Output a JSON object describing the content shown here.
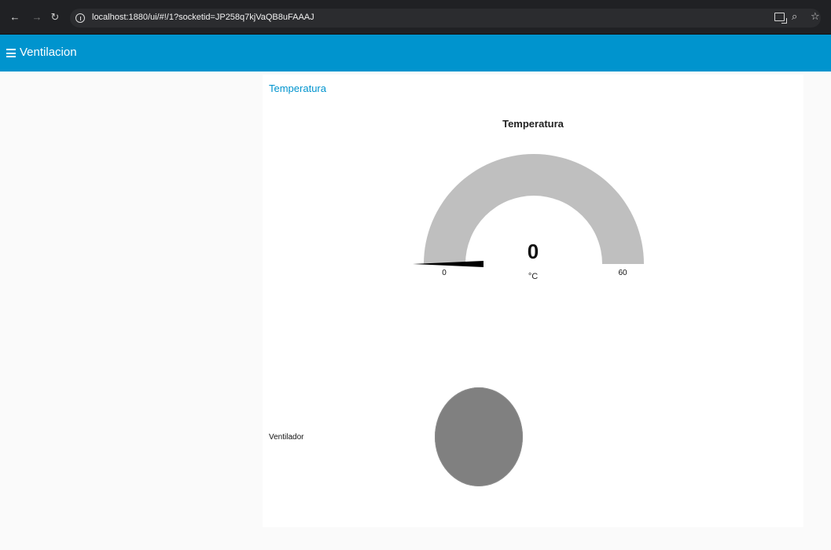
{
  "browser": {
    "url": "localhost:1880/ui/#!/1?socketid=JP258q7kjVaQB8uFAAAJ",
    "icons": [
      "back-arrow-icon",
      "forward-arrow-icon",
      "reload-icon",
      "info-icon",
      "cast-icon",
      "zoom-icon",
      "star-icon"
    ]
  },
  "header": {
    "title": "Ventilacion"
  },
  "group": {
    "title": "Temperatura"
  },
  "gauge": {
    "title": "Temperatura",
    "value": "0",
    "unit": "°C",
    "min": "0",
    "max": "60",
    "level": 0
  },
  "fan": {
    "label": "Ventilador",
    "state_color": "#808080"
  },
  "colors": {
    "header": "#0094ce",
    "gauge_track": "#bfbfbf",
    "needle": "#000000"
  }
}
